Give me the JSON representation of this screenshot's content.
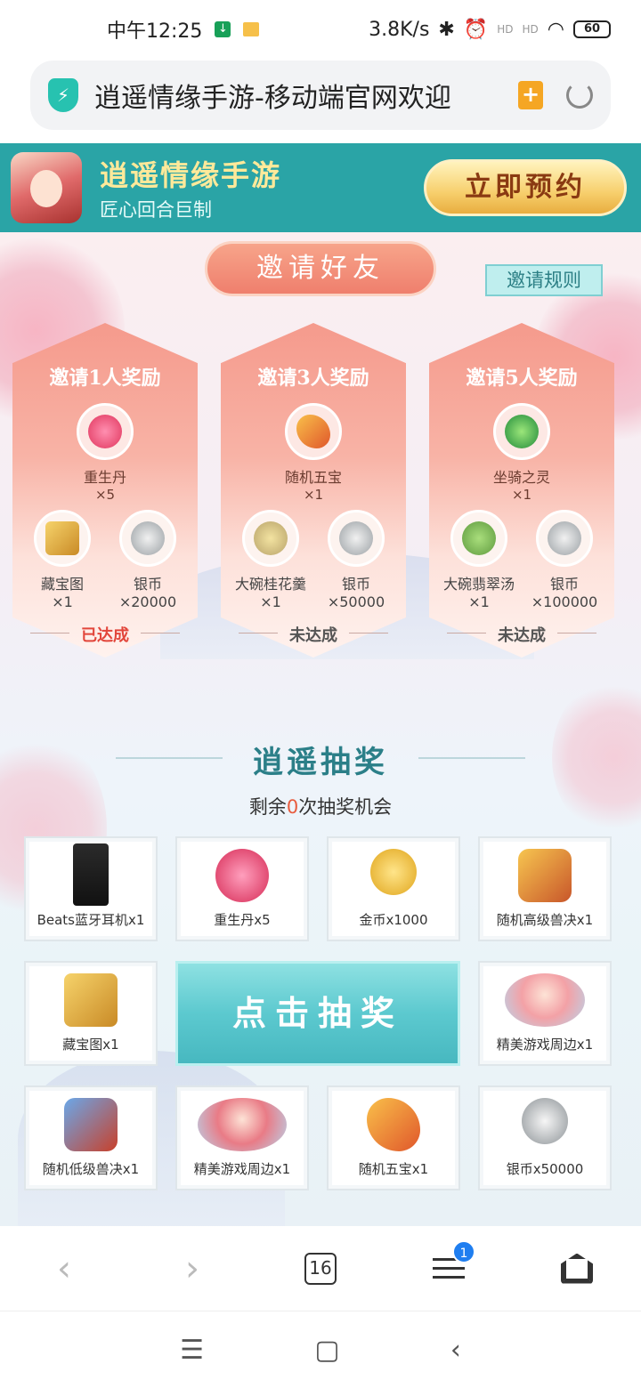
{
  "status_bar": {
    "time": "中午12:25",
    "net_speed": "3.8K/s",
    "signal1": "HD",
    "signal2": "HD",
    "battery": "60"
  },
  "browser": {
    "page_title": "逍遥情缘手游-移动端官网欢迎"
  },
  "banner": {
    "app_name": "逍遥情缘手游",
    "tagline": "匠心回合巨制",
    "reserve_label": "立即预约"
  },
  "invite": {
    "title": "邀请好友",
    "rules_label": "邀请规则",
    "cards": [
      {
        "title": "邀请1人奖励",
        "main": {
          "name": "重生丹",
          "qty": "×5"
        },
        "subs": [
          {
            "name": "藏宝图",
            "qty": "×1"
          },
          {
            "name": "银币",
            "qty": "×20000"
          }
        ],
        "state": "已达成"
      },
      {
        "title": "邀请3人奖励",
        "main": {
          "name": "随机五宝",
          "qty": "×1"
        },
        "subs": [
          {
            "name": "大碗桂花羹",
            "qty": "×1"
          },
          {
            "name": "银币",
            "qty": "×50000"
          }
        ],
        "state": "未达成"
      },
      {
        "title": "邀请5人奖励",
        "main": {
          "name": "坐骑之灵",
          "qty": "×1"
        },
        "subs": [
          {
            "name": "大碗翡翠汤",
            "qty": "×1"
          },
          {
            "name": "银币",
            "qty": "×100000"
          }
        ],
        "state": "未达成"
      }
    ]
  },
  "lottery": {
    "title": "逍遥抽奖",
    "remaining_prefix": "剩余",
    "remaining_count": "0",
    "remaining_suffix": "次抽奖机会",
    "draw_label": "点击抽奖",
    "prizes": [
      "Beats蓝牙耳机x1",
      "重生丹x5",
      "金币x1000",
      "随机高级兽决x1",
      "藏宝图x1",
      "精美游戏周边x1",
      "随机低级兽决x1",
      "精美游戏周边x1",
      "随机五宝x1",
      "银币x50000"
    ]
  },
  "bottom_nav": {
    "back": "‹",
    "forward": "›",
    "tab_count": "16",
    "menu_badge": "1"
  },
  "system_nav": {
    "recents": "☰",
    "home": "▢",
    "back": "‹"
  },
  "colors": {
    "banner_bg": "#2aa4a6",
    "accent_gold": "#f7cf6c",
    "invite_pink": "#ef7f6d",
    "teal_title": "#2b7f88",
    "done_red": "#e2463b"
  }
}
